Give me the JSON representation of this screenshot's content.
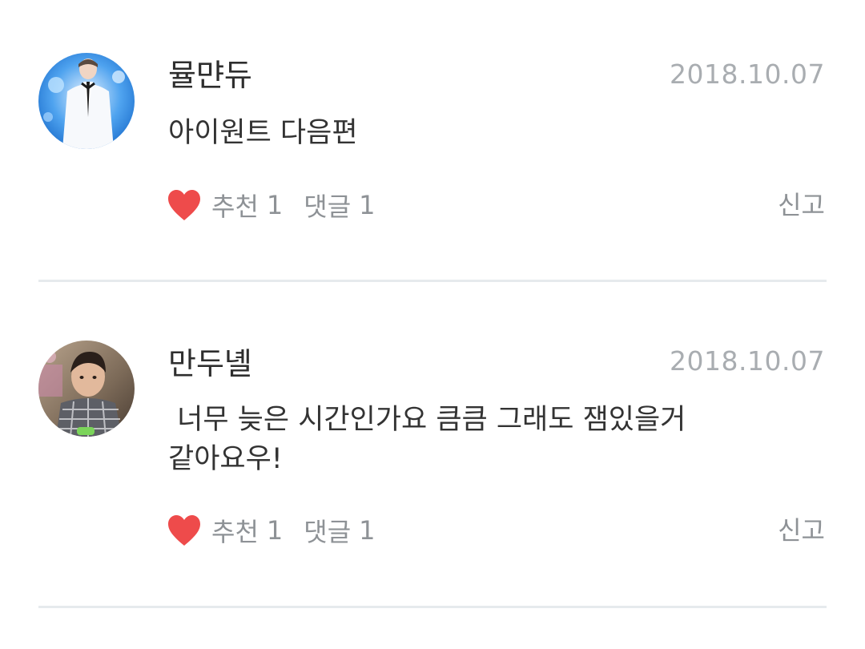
{
  "comments": [
    {
      "author": "뮬먄듀",
      "date": "2018.10.07",
      "text": "아이원트 다음편",
      "like_label": "추천",
      "like_count": "1",
      "reply_label": "댓글",
      "reply_count": "1",
      "report_label": "신고",
      "avatar_icon": "avatar-photo-white-suit"
    },
    {
      "author": "만두녤",
      "date": "2018.10.07",
      "text": " 너무 늦은 시간인가요 큼큼 그래도 잼있을거 같아요우!",
      "like_label": "추천",
      "like_count": "1",
      "reply_label": "댓글",
      "reply_count": "1",
      "report_label": "신고",
      "avatar_icon": "avatar-photo-plaid-shirt"
    }
  ],
  "colors": {
    "heart": "#ee4b4b",
    "meta_text": "#8e9296",
    "date_text": "#a9adb1",
    "divider": "#e6eaed"
  }
}
